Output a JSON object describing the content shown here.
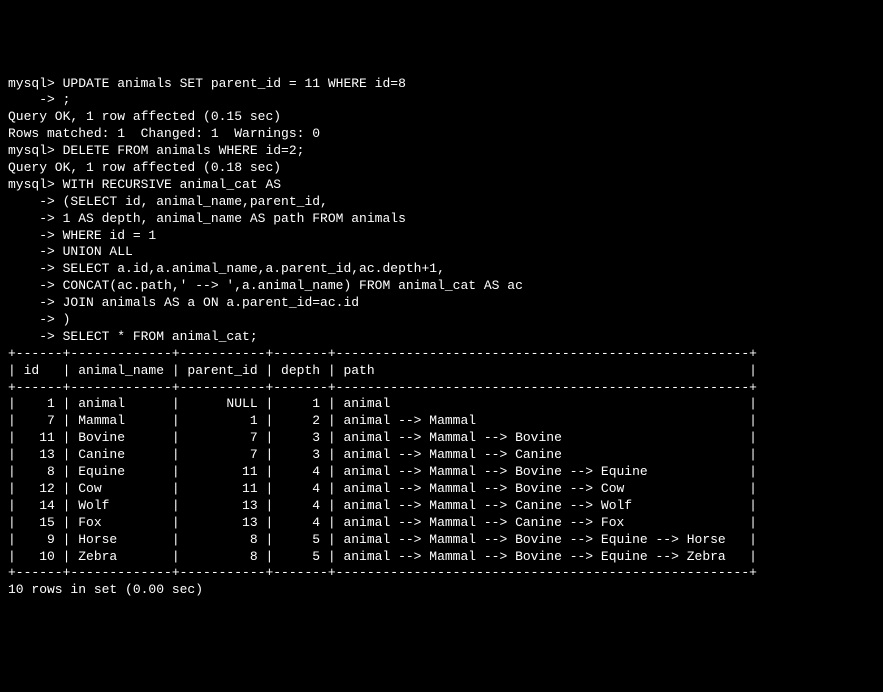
{
  "lines": [
    "mysql> UPDATE animals SET parent_id = 11 WHERE id=8",
    "    -> ;",
    "Query OK, 1 row affected (0.15 sec)",
    "Rows matched: 1  Changed: 1  Warnings: 0",
    "",
    "mysql> DELETE FROM animals WHERE id=2;",
    "Query OK, 1 row affected (0.18 sec)",
    "",
    "mysql> WITH RECURSIVE animal_cat AS",
    "    -> (SELECT id, animal_name,parent_id,",
    "    -> 1 AS depth, animal_name AS path FROM animals",
    "    -> WHERE id = 1",
    "    -> UNION ALL",
    "    -> SELECT a.id,a.animal_name,a.parent_id,ac.depth+1,",
    "    -> CONCAT(ac.path,' --> ',a.animal_name) FROM animal_cat AS ac",
    "    -> JOIN animals AS a ON a.parent_id=ac.id",
    "    -> )",
    "    -> SELECT * FROM animal_cat;",
    "+------+-------------+-----------+-------+-----------------------------------------------------+",
    "| id   | animal_name | parent_id | depth | path                                                |",
    "+------+-------------+-----------+-------+-----------------------------------------------------+",
    "|    1 | animal      |      NULL |     1 | animal                                              |",
    "|    7 | Mammal      |         1 |     2 | animal --> Mammal                                   |",
    "|   11 | Bovine      |         7 |     3 | animal --> Mammal --> Bovine                        |",
    "|   13 | Canine      |         7 |     3 | animal --> Mammal --> Canine                        |",
    "|    8 | Equine      |        11 |     4 | animal --> Mammal --> Bovine --> Equine             |",
    "|   12 | Cow         |        11 |     4 | animal --> Mammal --> Bovine --> Cow                |",
    "|   14 | Wolf        |        13 |     4 | animal --> Mammal --> Canine --> Wolf               |",
    "|   15 | Fox         |        13 |     4 | animal --> Mammal --> Canine --> Fox                |",
    "|    9 | Horse       |         8 |     5 | animal --> Mammal --> Bovine --> Equine --> Horse   |",
    "|   10 | Zebra       |         8 |     5 | animal --> Mammal --> Bovine --> Equine --> Zebra   |",
    "+------+-------------+-----------+-------+-----------------------------------------------------+",
    "10 rows in set (0.00 sec)"
  ],
  "chart_data": {
    "type": "table",
    "columns": [
      "id",
      "animal_name",
      "parent_id",
      "depth",
      "path"
    ],
    "rows": [
      {
        "id": 1,
        "animal_name": "animal",
        "parent_id": null,
        "depth": 1,
        "path": "animal"
      },
      {
        "id": 7,
        "animal_name": "Mammal",
        "parent_id": 1,
        "depth": 2,
        "path": "animal --> Mammal"
      },
      {
        "id": 11,
        "animal_name": "Bovine",
        "parent_id": 7,
        "depth": 3,
        "path": "animal --> Mammal --> Bovine"
      },
      {
        "id": 13,
        "animal_name": "Canine",
        "parent_id": 7,
        "depth": 3,
        "path": "animal --> Mammal --> Canine"
      },
      {
        "id": 8,
        "animal_name": "Equine",
        "parent_id": 11,
        "depth": 4,
        "path": "animal --> Mammal --> Bovine --> Equine"
      },
      {
        "id": 12,
        "animal_name": "Cow",
        "parent_id": 11,
        "depth": 4,
        "path": "animal --> Mammal --> Bovine --> Cow"
      },
      {
        "id": 14,
        "animal_name": "Wolf",
        "parent_id": 13,
        "depth": 4,
        "path": "animal --> Mammal --> Canine --> Wolf"
      },
      {
        "id": 15,
        "animal_name": "Fox",
        "parent_id": 13,
        "depth": 4,
        "path": "animal --> Mammal --> Canine --> Fox"
      },
      {
        "id": 9,
        "animal_name": "Horse",
        "parent_id": 8,
        "depth": 5,
        "path": "animal --> Mammal --> Bovine --> Equine --> Horse"
      },
      {
        "id": 10,
        "animal_name": "Zebra",
        "parent_id": 8,
        "depth": 5,
        "path": "animal --> Mammal --> Bovine --> Equine --> Zebra"
      }
    ]
  }
}
